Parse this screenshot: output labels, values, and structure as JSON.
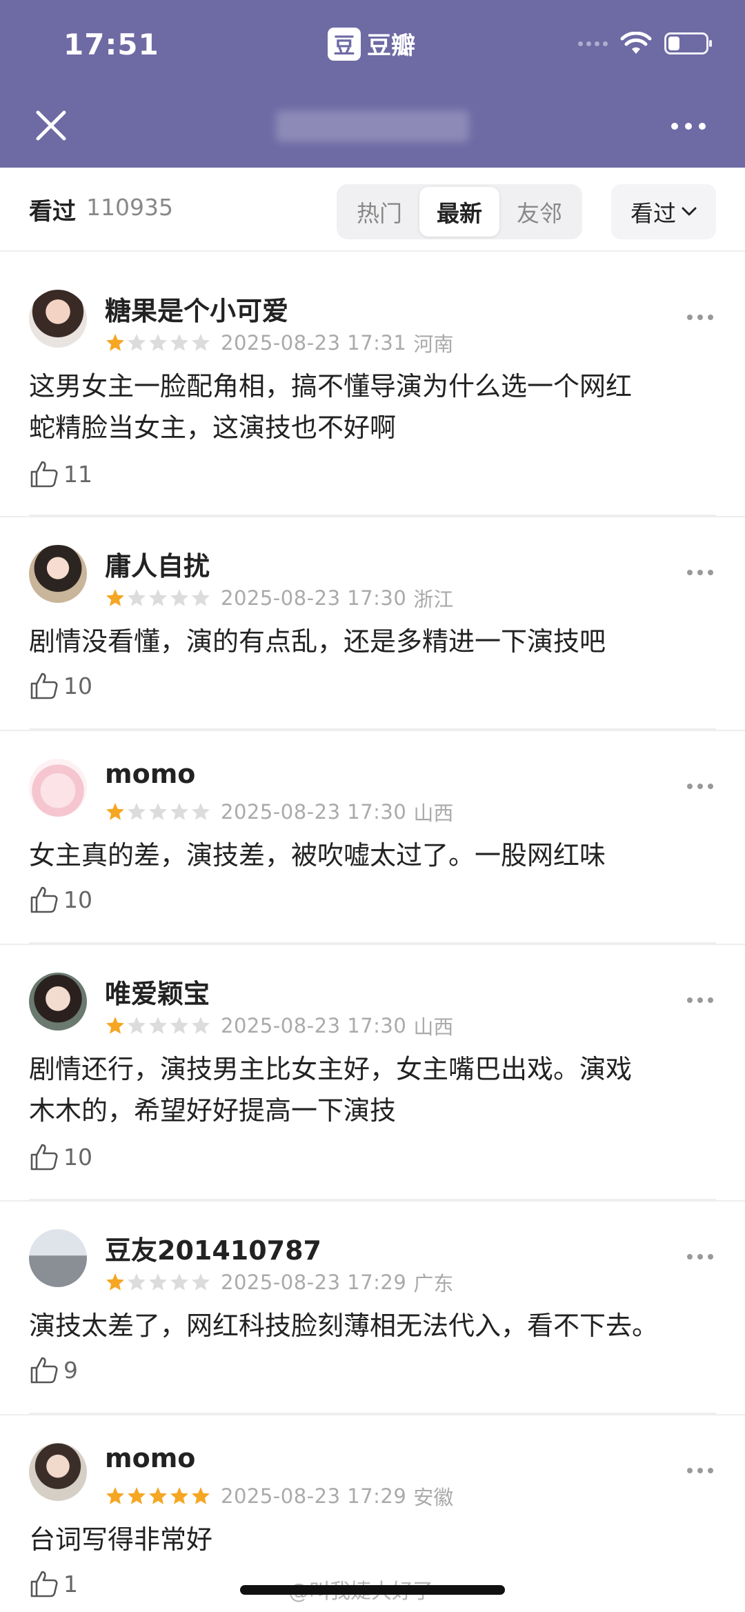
{
  "status_bar": {
    "time": "17:51",
    "app_name": "豆瓣",
    "app_logo_char": "豆",
    "battery_level_percent": 30
  },
  "header": {
    "bg_color": "#6e6aa4"
  },
  "filter_bar": {
    "seen_label": "看过",
    "seen_count": "110935",
    "tabs": [
      {
        "label": "热门",
        "active": false
      },
      {
        "label": "最新",
        "active": true
      },
      {
        "label": "友邻",
        "active": false
      }
    ],
    "dropdown_label": "看过"
  },
  "rating_star_color": "#f5a623",
  "comments": [
    {
      "username": "糖果是个小可爱",
      "rating": 1,
      "date": "2025-08-23 17:31",
      "location": "河南",
      "lines": [
        "这男女主一脸配角相，搞不懂导演为什么选一个网红",
        "蛇精脸当女主，这演技也不好啊"
      ],
      "likes": "11"
    },
    {
      "username": "庸人自扰",
      "rating": 1,
      "date": "2025-08-23 17:30",
      "location": "浙江",
      "lines": [
        "剧情没看懂，演的有点乱，还是多精进一下演技吧"
      ],
      "likes": "10"
    },
    {
      "username": "momo",
      "rating": 1,
      "date": "2025-08-23 17:30",
      "location": "山西",
      "lines": [
        "女主真的差，演技差，被吹嘘太过了。一股网红味"
      ],
      "likes": "10"
    },
    {
      "username": "唯爱颖宝",
      "rating": 1,
      "date": "2025-08-23 17:30",
      "location": "山西",
      "lines": [
        "剧情还行，演技男主比女主好，女主嘴巴出戏。演戏",
        "木木的，希望好好提高一下演技"
      ],
      "likes": "10"
    },
    {
      "username": "豆友201410787",
      "rating": 1,
      "date": "2025-08-23 17:29",
      "location": "广东",
      "lines": [
        "演技太差了，网红科技脸刻薄相无法代入，看不下去。"
      ],
      "likes": "9"
    },
    {
      "username": "momo",
      "rating": 5,
      "date": "2025-08-23 17:29",
      "location": "安徽",
      "lines": [
        "台词写得非常好"
      ],
      "likes": "1"
    }
  ],
  "watermark": "@叫我婕大好了"
}
